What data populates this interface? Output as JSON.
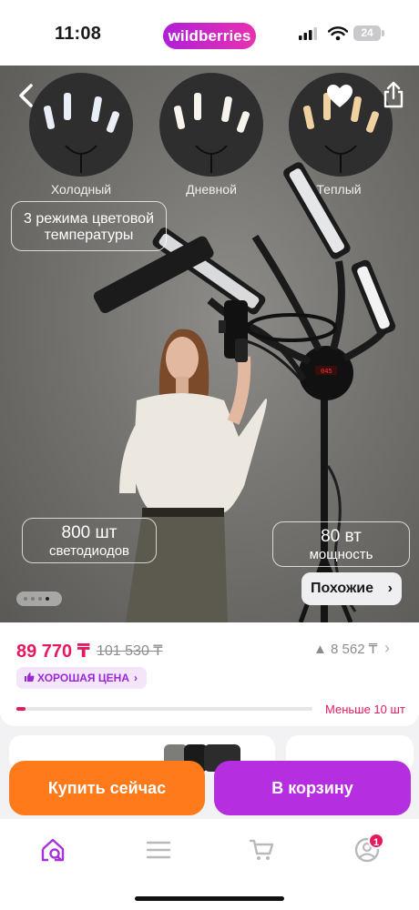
{
  "status_bar": {
    "time": "11:08",
    "brand": "wildberries",
    "battery": "24"
  },
  "hero": {
    "modes": [
      {
        "label": "Холодный",
        "light_color": "#e9eef7"
      },
      {
        "label": "Дневной",
        "light_color": "#f6f4ec"
      },
      {
        "label": "Теплый",
        "light_color": "#f0d2a0"
      }
    ],
    "temperature_note": {
      "line1": "3 режима цветовой",
      "line2": "температуры"
    },
    "leds": {
      "value": "800 шт",
      "label": "светодиодов"
    },
    "power": {
      "value": "80 вт",
      "label": "мощность"
    },
    "similar_label": "Похожие",
    "similar_chevron": "›",
    "carousel": {
      "count": 4,
      "active_index": 3
    }
  },
  "pricing": {
    "price": "89 770 ₸",
    "old_price": "101 530 ₸",
    "delta": "▲ 8 562 ₸",
    "delta_chevron": "›",
    "badge": "ХОРОШАЯ ЦЕНА",
    "stock_label": "Меньше 10 шт",
    "stock_fill_fraction": 0.03
  },
  "actions": {
    "buy_now": "Купить сейчас",
    "add_to_cart": "В корзину"
  },
  "tabbar": {
    "items": [
      {
        "name": "home",
        "icon": "home-search-icon",
        "active": true
      },
      {
        "name": "catalog",
        "icon": "menu-icon"
      },
      {
        "name": "cart",
        "icon": "cart-icon"
      },
      {
        "name": "profile",
        "icon": "profile-icon",
        "badge": "1"
      }
    ]
  },
  "colors": {
    "accent": "#b52ee0",
    "price": "#e5195e",
    "buy": "#ff7a1a"
  }
}
